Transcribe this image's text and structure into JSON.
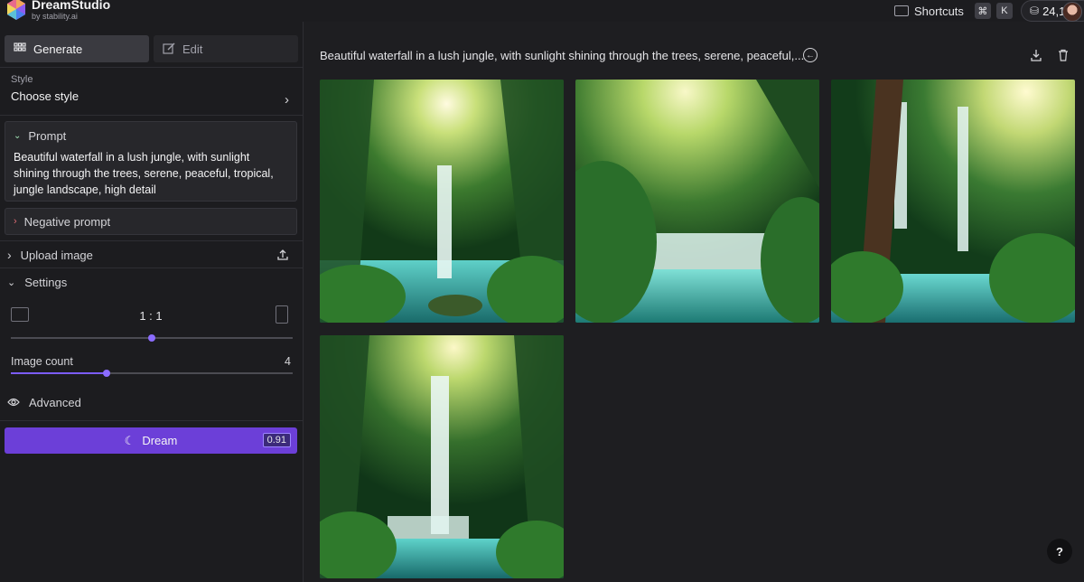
{
  "app": {
    "name": "DreamStudio",
    "subtitle": "by stability.ai"
  },
  "topbar": {
    "shortcuts_label": "Shortcuts",
    "key_cmd": "⌘",
    "key_k": "K",
    "credits": "24,1"
  },
  "sidebar": {
    "tabs": [
      {
        "label": "Generate",
        "icon": "grid-icon"
      },
      {
        "label": "Edit",
        "icon": "edit-icon"
      }
    ],
    "style": {
      "label": "Style",
      "value": "Choose style"
    },
    "prompt": {
      "label": "Prompt",
      "text": "Beautiful waterfall in a lush jungle, with sunlight shining through the trees, serene, peaceful, tropical, jungle landscape, high detail"
    },
    "negative_prompt": {
      "label": "Negative prompt"
    },
    "upload_image": {
      "label": "Upload image"
    },
    "settings": {
      "label": "Settings",
      "aspect_ratio": "1 : 1",
      "aspect_ratio_slider": 0.5,
      "image_count_label": "Image count",
      "image_count_value": "4",
      "image_count_slider": 0.34
    },
    "advanced": {
      "label": "Advanced"
    },
    "dream_button": {
      "label": "Dream",
      "cost": "0.91"
    }
  },
  "main": {
    "prompt_preview": "Beautiful waterfall in a lush jungle, with sunlight shining through the trees, serene, peaceful,...",
    "images": [
      {
        "name": "generated-image-1"
      },
      {
        "name": "generated-image-2"
      },
      {
        "name": "generated-image-3"
      },
      {
        "name": "generated-image-4"
      }
    ],
    "help_label": "?"
  },
  "colors": {
    "accent": "#6c3fd8",
    "background": "#1e1e21",
    "sidebar": "#1c1c1f"
  }
}
